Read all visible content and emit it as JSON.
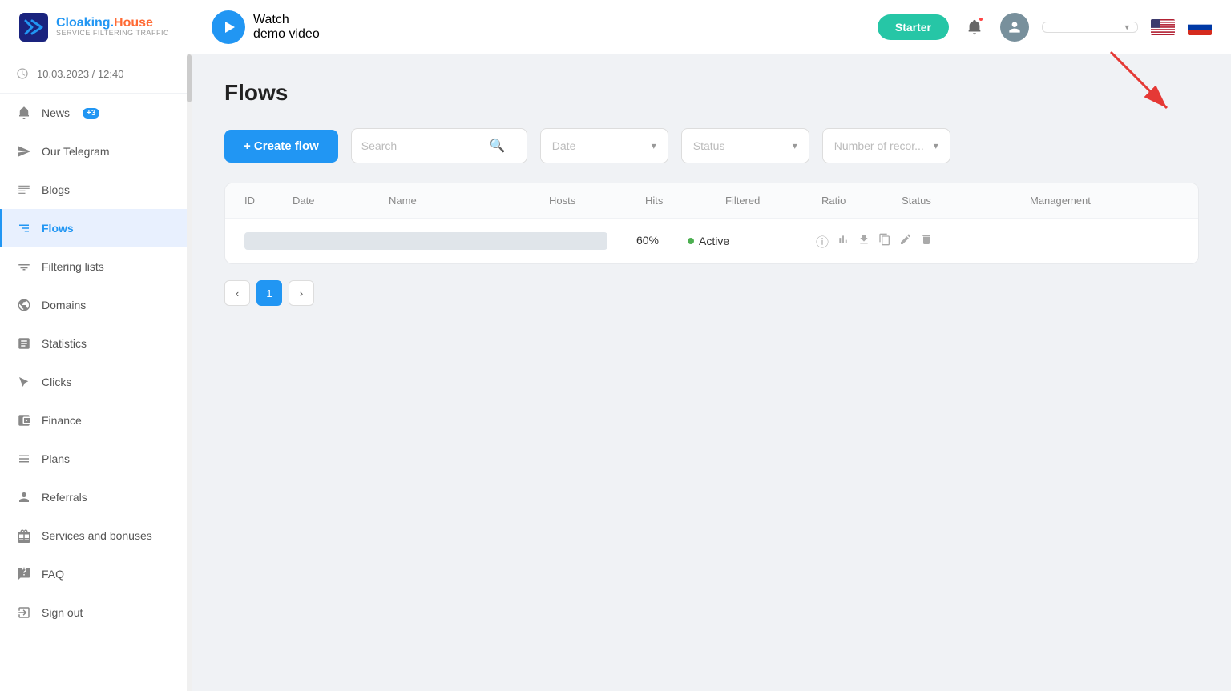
{
  "topbar": {
    "logo": {
      "brand": "Cloaking.House",
      "subtitle": "Service Filtering Traffic"
    },
    "demo_video": {
      "watch": "Watch",
      "demo": "demo video"
    },
    "starter_label": "Starter",
    "user_name": "",
    "lang_us": "US",
    "lang_ru": "RU"
  },
  "sidebar": {
    "datetime": "10.03.2023 / 12:40",
    "items": [
      {
        "id": "news",
        "label": "News",
        "badge": "+3",
        "icon": "bell-icon"
      },
      {
        "id": "our-telegram",
        "label": "Our Telegram",
        "badge": null,
        "icon": "telegram-icon"
      },
      {
        "id": "blogs",
        "label": "Blogs",
        "badge": null,
        "icon": "blog-icon"
      },
      {
        "id": "flows",
        "label": "Flows",
        "badge": null,
        "icon": "flow-icon",
        "active": true
      },
      {
        "id": "filtering-lists",
        "label": "Filtering lists",
        "badge": null,
        "icon": "filter-icon"
      },
      {
        "id": "domains",
        "label": "Domains",
        "badge": null,
        "icon": "domain-icon"
      },
      {
        "id": "statistics",
        "label": "Statistics",
        "badge": null,
        "icon": "stats-icon"
      },
      {
        "id": "clicks",
        "label": "Clicks",
        "badge": null,
        "icon": "clicks-icon"
      },
      {
        "id": "finance",
        "label": "Finance",
        "badge": null,
        "icon": "finance-icon"
      },
      {
        "id": "plans",
        "label": "Plans",
        "badge": null,
        "icon": "plans-icon"
      },
      {
        "id": "referrals",
        "label": "Referrals",
        "badge": null,
        "icon": "referrals-icon"
      },
      {
        "id": "services-bonuses",
        "label": "Services and bonuses",
        "badge": null,
        "icon": "gift-icon"
      },
      {
        "id": "faq",
        "label": "FAQ",
        "badge": null,
        "icon": "faq-icon"
      },
      {
        "id": "sign-out",
        "label": "Sign out",
        "badge": null,
        "icon": "signout-icon"
      }
    ]
  },
  "page": {
    "title": "Flows",
    "create_flow_label": "+ Create flow",
    "search_placeholder": "Search",
    "date_placeholder": "Date",
    "status_placeholder": "Status",
    "records_placeholder": "Number of recor...",
    "table": {
      "columns": [
        "ID",
        "Date",
        "Name",
        "Hosts",
        "Hits",
        "Filtered",
        "Ratio",
        "Status",
        "Management"
      ],
      "rows": [
        {
          "id": "",
          "date": "",
          "name": "",
          "hosts": "",
          "hits": "",
          "filtered": "",
          "ratio": "60%",
          "status": "Active",
          "status_color": "#4caf50"
        }
      ]
    },
    "pagination": {
      "current": 1,
      "total": 1
    }
  }
}
